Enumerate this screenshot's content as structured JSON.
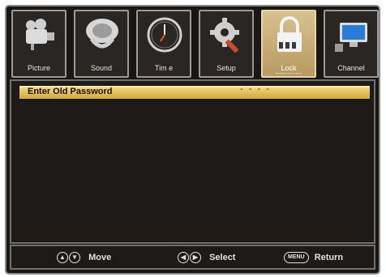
{
  "tabs": [
    {
      "label": "Picture",
      "icon": "camera-icon"
    },
    {
      "label": "Sound",
      "icon": "speaker-icon"
    },
    {
      "label": "Tim e",
      "icon": "clock-icon"
    },
    {
      "label": "Setup",
      "icon": "gear-wrench-icon"
    },
    {
      "label": "Lock",
      "icon": "padlock-icon",
      "active": true
    },
    {
      "label": "Channel",
      "icon": "tv-monitor-icon"
    }
  ],
  "panel": {
    "row_label": "Enter Old Password",
    "password_value": "- - - -"
  },
  "footer": {
    "move_label": "Move",
    "select_label": "Select",
    "menu_key": "MENU",
    "return_label": "Return"
  },
  "colors": {
    "accent": "#d8b660",
    "background": "#1a1614"
  }
}
